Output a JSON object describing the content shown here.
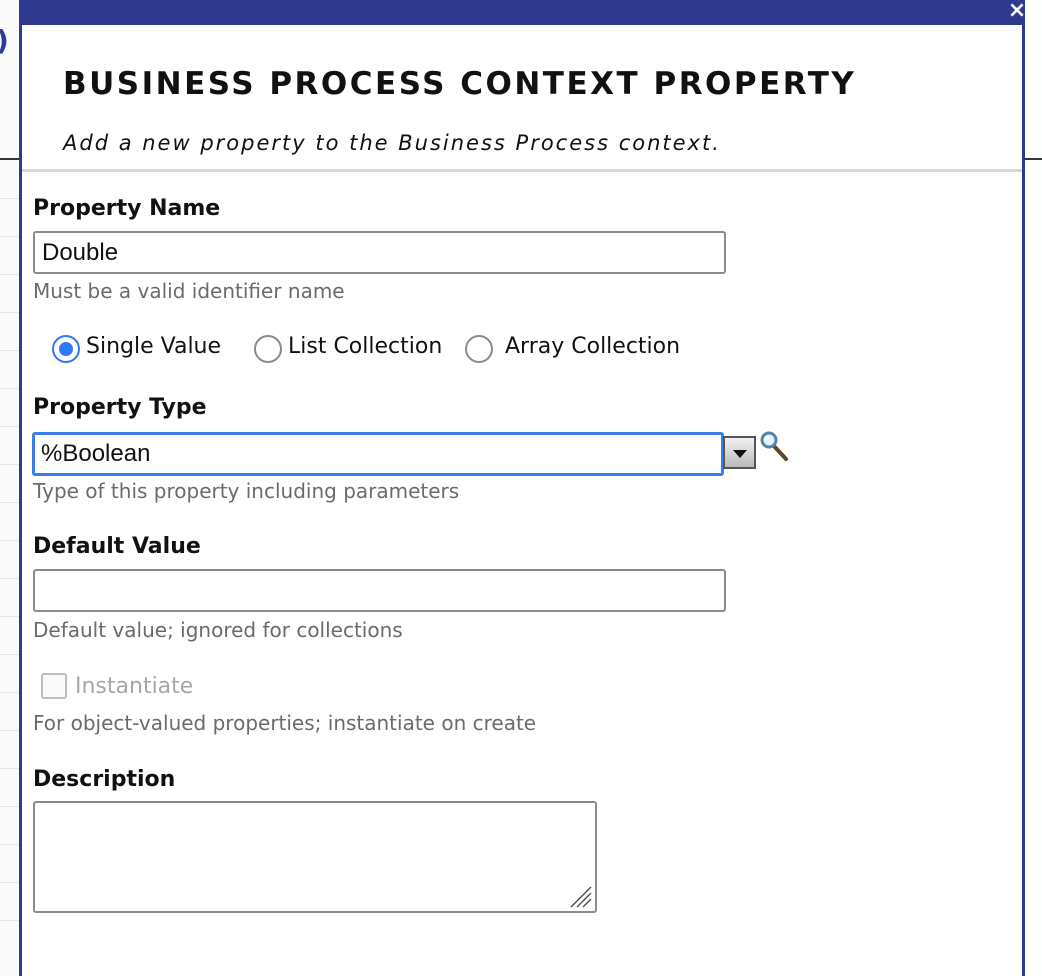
{
  "dialog": {
    "title": "BUSINESS PROCESS CONTEXT PROPERTY",
    "subtitle": "Add a new property to the Business Process context.",
    "close_label": "×"
  },
  "background": {
    "paren": ")"
  },
  "property_name": {
    "label": "Property Name",
    "value": "Double",
    "hint": "Must be a valid identifier name"
  },
  "collection_type": {
    "options": [
      {
        "label": "Single Value",
        "checked": true
      },
      {
        "label": "List Collection",
        "checked": false
      },
      {
        "label": "Array Collection",
        "checked": false
      }
    ]
  },
  "property_type": {
    "label": "Property Type",
    "value": "%Boolean",
    "hint": "Type of this property including parameters"
  },
  "default_value": {
    "label": "Default Value",
    "value": "",
    "hint": "Default value; ignored for collections"
  },
  "instantiate": {
    "label": "Instantiate",
    "checked": false,
    "disabled": true,
    "hint": "For object-valued properties; instantiate on create"
  },
  "description": {
    "label": "Description",
    "value": ""
  },
  "colors": {
    "accent": "#2f3a8f",
    "focus": "#3a7ee8",
    "radio_checked": "#2f7af0"
  }
}
